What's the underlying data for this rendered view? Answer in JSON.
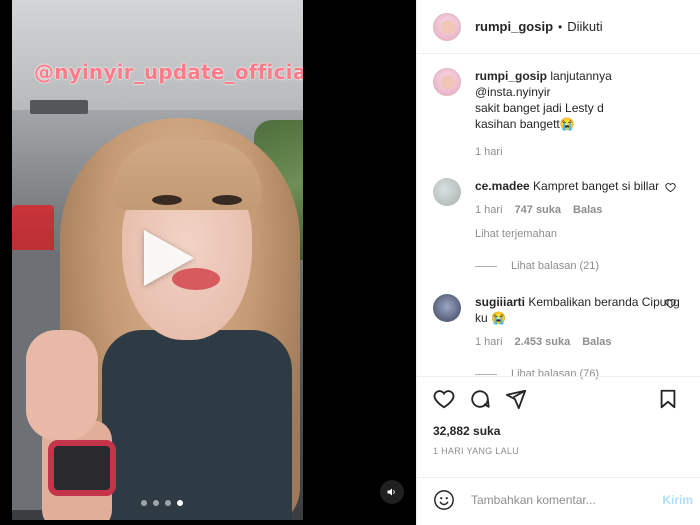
{
  "video": {
    "watermark": "@nyinyir_update_official",
    "carousel_dots": 4,
    "active_dot": 4
  },
  "header": {
    "username": "rumpi_gosip",
    "separator": "•",
    "follow_status": "Diikuti"
  },
  "caption": {
    "username": "rumpi_gosip",
    "text_line1": "lanjutannya",
    "text_line2": "@insta.nyinyir",
    "text_line3": "sakit banget jadi Lesty d",
    "text_line4": "kasihan bangett😭",
    "time": "1 hari"
  },
  "comments": [
    {
      "username": "ce.madee",
      "text": "Kampret banget si billar",
      "time": "1 hari",
      "likes": "747 suka",
      "reply": "Balas",
      "translate": "Lihat terjemahan",
      "view_replies": "Lihat balasan (21)"
    },
    {
      "username": "sugiiiarti",
      "text": "Kembalikan beranda Cipung ku 😭",
      "time": "1 hari",
      "likes": "2.453 suka",
      "reply": "Balas",
      "view_replies": "Lihat balasan (76)"
    }
  ],
  "post": {
    "likes": "32,882 suka",
    "time_ago": "1 HARI YANG LALU"
  },
  "add_comment": {
    "placeholder": "Tambahkan komentar...",
    "post_label": "Kirim"
  },
  "icons": {
    "like": "heart-icon",
    "comment": "comment-icon",
    "share": "share-icon",
    "save": "bookmark-icon",
    "emoji": "emoji-icon",
    "sound": "speaker-icon",
    "play": "play-icon"
  }
}
